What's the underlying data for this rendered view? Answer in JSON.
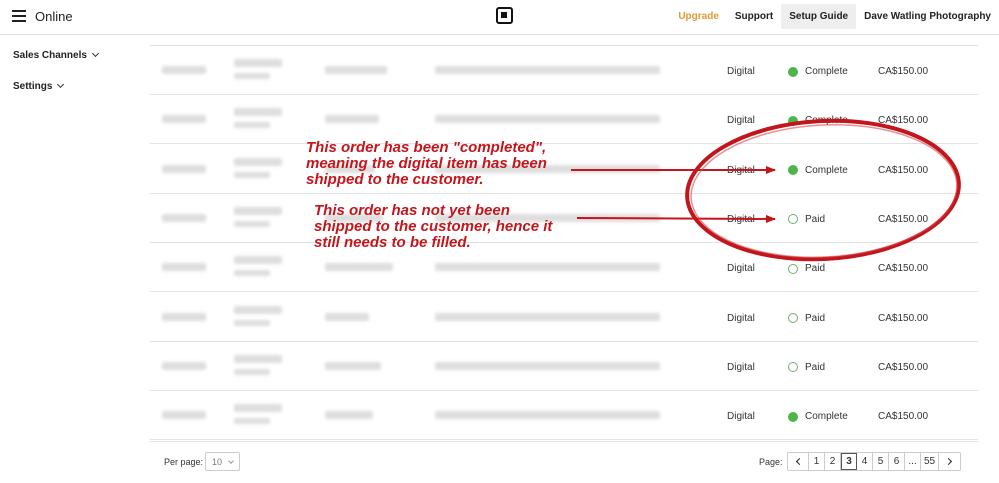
{
  "header": {
    "app_title": "Online",
    "nav": {
      "upgrade": "Upgrade",
      "support": "Support",
      "setup_guide": "Setup Guide",
      "account": "Dave Watling Photography"
    },
    "accent_color": "#e09b32"
  },
  "sidebar": {
    "items": [
      {
        "label": "Sales Channels"
      },
      {
        "label": "Settings"
      }
    ]
  },
  "orders": {
    "rows": [
      {
        "format": "Digital",
        "status": "Complete",
        "total": "CA$150.00"
      },
      {
        "format": "Digital",
        "status": "Complete",
        "total": "CA$150.00"
      },
      {
        "format": "Digital",
        "status": "Complete",
        "total": "CA$150.00"
      },
      {
        "format": "Digital",
        "status": "Paid",
        "total": "CA$150.00"
      },
      {
        "format": "Digital",
        "status": "Paid",
        "total": "CA$150.00"
      },
      {
        "format": "Digital",
        "status": "Paid",
        "total": "CA$150.00"
      },
      {
        "format": "Digital",
        "status": "Paid",
        "total": "CA$150.00"
      },
      {
        "format": "Digital",
        "status": "Complete",
        "total": "CA$150.00"
      }
    ],
    "status_colors": {
      "Complete": "#4fb44a",
      "Paid": "#6fae6a"
    }
  },
  "annotations": {
    "completed_note": [
      "This order has been \"completed\",",
      "meaning the digital item has been",
      "shipped to the customer."
    ],
    "paid_note": [
      "This order has not yet been",
      "shipped to the customer, hence it",
      "still needs to be filled."
    ],
    "color": "#c3161c"
  },
  "pagination": {
    "per_page_label": "Per page:",
    "per_page_value": "10",
    "page_label": "Page:",
    "pages": [
      "1",
      "2",
      "3",
      "4",
      "5",
      "6",
      "...",
      "55"
    ],
    "current_page": "3"
  }
}
